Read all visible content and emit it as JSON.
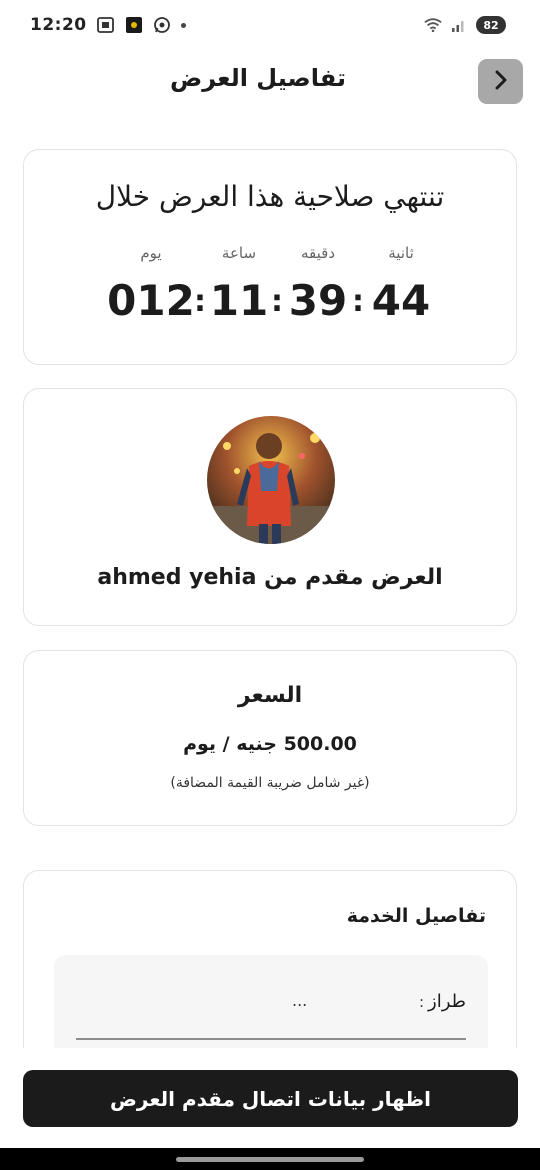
{
  "status_bar": {
    "time": "12:20",
    "battery": "82"
  },
  "header": {
    "title": "تفاصيل العرض"
  },
  "timer": {
    "title": "تنتهي صلاحية هذا العرض خلال",
    "labels": {
      "seconds": "ثانية",
      "minutes": "دقيقه",
      "hours": "ساعة",
      "days": "يوم"
    },
    "values": {
      "seconds": "44",
      "minutes": "39",
      "hours": "11",
      "days": "012"
    },
    "separator": ":"
  },
  "provider": {
    "text": "العرض مقدم من ahmed yehia"
  },
  "price": {
    "title": "السعر",
    "value": "500.00 جنيه / يوم",
    "note": "(غير شامل ضريبة القيمة المضافة)"
  },
  "service": {
    "title": "تفاصيل الخدمة",
    "field_label": "طراز",
    "field_colon": ":",
    "field_value": "..."
  },
  "actions": {
    "contact_button": "اظهار بيانات اتصال مقدم العرض"
  },
  "colors": {
    "button_bg": "#1b1b1b",
    "back_button_bg": "#a8a8a8",
    "card_border": "#e3e3e3"
  },
  "icons": [
    "image-icon",
    "app-icon",
    "whatsapp-icon",
    "wifi-icon",
    "signal-icon",
    "chevron-right-icon"
  ]
}
